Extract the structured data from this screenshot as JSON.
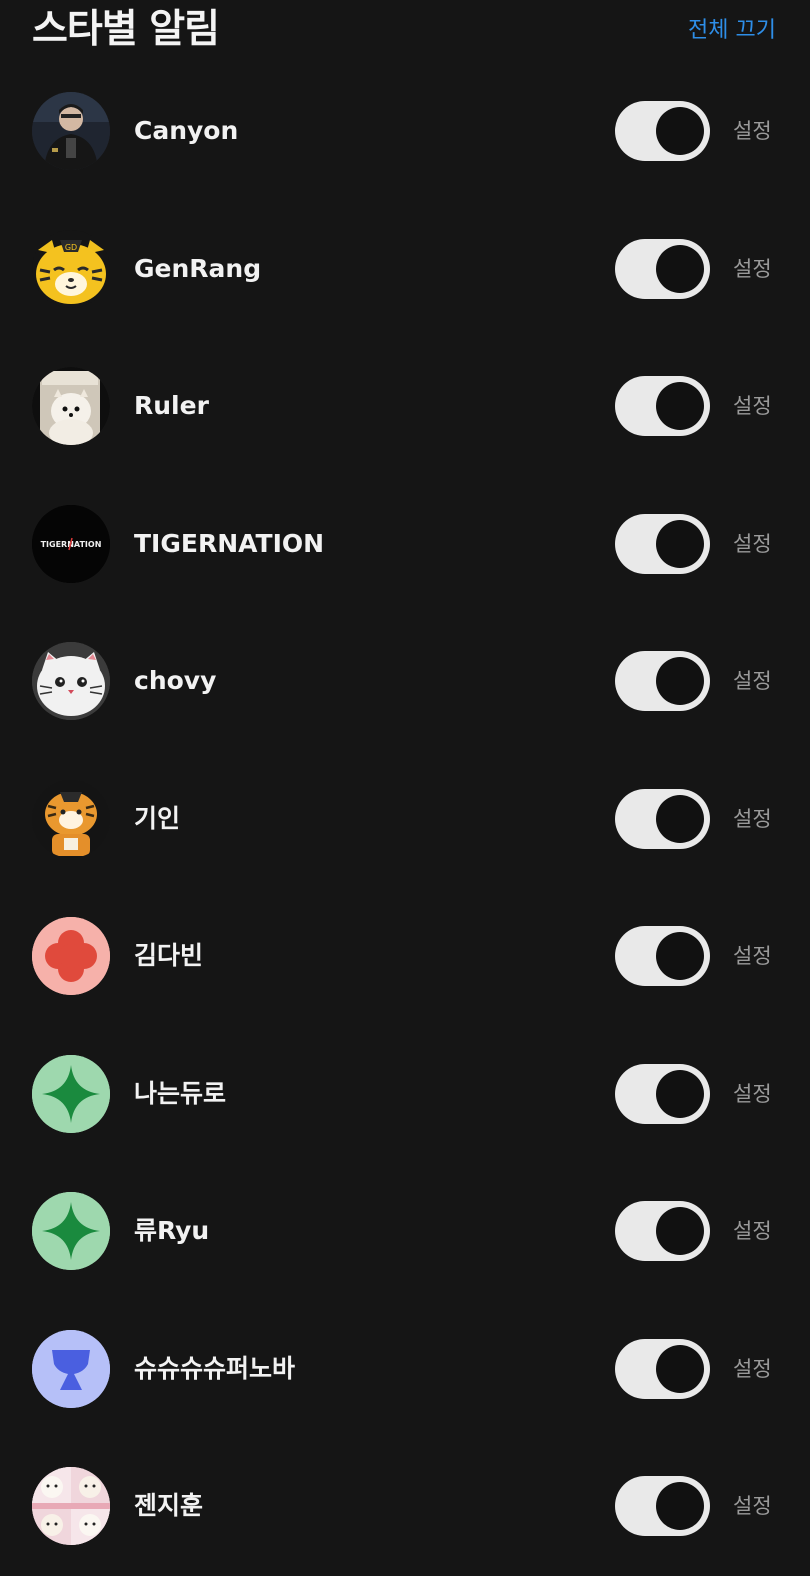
{
  "header": {
    "title": "스타별 알림",
    "off_all": "전체 끄기"
  },
  "stars": [
    {
      "name": "Canyon",
      "avatar": "photo-player-icon",
      "enabled": true,
      "setting_label": "설정"
    },
    {
      "name": "GenRang",
      "avatar": "tiger-mascot-icon",
      "enabled": true,
      "setting_label": "설정"
    },
    {
      "name": "Ruler",
      "avatar": "dog-photo-icon",
      "enabled": true,
      "setting_label": "설정"
    },
    {
      "name": "TIGERNATION",
      "avatar": "tigernation-logo",
      "logo_text": "TIGERNATION",
      "enabled": true,
      "setting_label": "설정"
    },
    {
      "name": "chovy",
      "avatar": "cat-plush-icon",
      "enabled": true,
      "setting_label": "설정"
    },
    {
      "name": "기인",
      "avatar": "tiger-plush-icon",
      "enabled": true,
      "setting_label": "설정"
    },
    {
      "name": "김다빈",
      "avatar": "red-flower-icon",
      "enabled": true,
      "setting_label": "설정"
    },
    {
      "name": "나는듀로",
      "avatar": "green-sparkle-icon",
      "enabled": true,
      "setting_label": "설정"
    },
    {
      "name": "류Ryu",
      "avatar": "green-sparkle-icon",
      "enabled": true,
      "setting_label": "설정"
    },
    {
      "name": "슈슈슈슈퍼노바",
      "avatar": "blue-cup-icon",
      "enabled": true,
      "setting_label": "설정"
    },
    {
      "name": "젠지훈",
      "avatar": "dog-collage-icon",
      "enabled": true,
      "setting_label": "설정"
    }
  ],
  "colors": {
    "background": "#151515",
    "accent": "#2e8ee8",
    "toggle_track": "#e9e9e9",
    "toggle_knob": "#111111"
  }
}
